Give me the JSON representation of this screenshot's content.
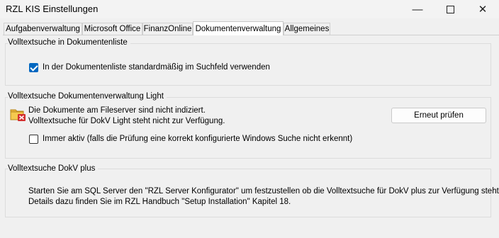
{
  "window": {
    "title": "RZL KIS Einstellungen"
  },
  "tabs": [
    {
      "label": "Aufgabenverwaltung"
    },
    {
      "label": "Microsoft Office"
    },
    {
      "label": "FinanzOnline"
    },
    {
      "label": "Dokumentenverwaltung"
    },
    {
      "label": "Allgemeines"
    }
  ],
  "groups": {
    "fulltext_list": {
      "title": "Volltextsuche in Dokumentenliste",
      "checkbox_label": "In der Dokumentenliste standardmäßig im Suchfeld verwenden",
      "checked": true
    },
    "fulltext_light": {
      "title": "Volltextsuche Dokumentenverwaltung Light",
      "status_line1": "Die Dokumente am Fileserver sind nicht indiziert.",
      "status_line2": "Volltextsuche für DokV Light steht nicht zur Verfügung.",
      "recheck_button": "Erneut prüfen",
      "checkbox_label": "Immer aktiv (falls die Prüfung eine korrekt konfigurierte Windows Suche nicht erkennt)",
      "checked": false
    },
    "fulltext_plus": {
      "title": "Volltextsuche DokV plus",
      "info_line1": "Starten Sie am SQL Server den \"RZL Server Konfigurator\" um festzustellen ob die Volltextsuche für DokV plus zur Verfügung steht.",
      "info_line2": "Details dazu finden Sie im RZL Handbuch \"Setup Installation\" Kapitel 18."
    }
  },
  "icons": {
    "minimize": "minimize-icon",
    "maximize": "maximize-icon",
    "close": "close-icon",
    "status": "folder-error-icon"
  },
  "colors": {
    "accent": "#0067c0",
    "error": "#d32f2f",
    "folder": "#e8b23a"
  }
}
